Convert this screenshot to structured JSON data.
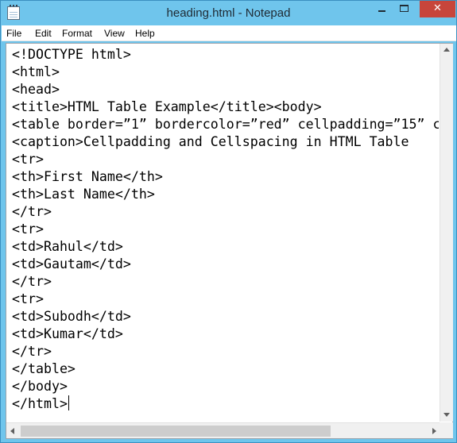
{
  "window": {
    "title": "heading.html - Notepad",
    "close_glyph": "✕",
    "app_icon": "notepad-icon"
  },
  "menu": [
    "File",
    "Edit",
    "Format",
    "View",
    "Help"
  ],
  "editor": {
    "lines": [
      "<!DOCTYPE html>",
      "<html>",
      "<head>",
      "<title>HTML Table Example</title><body>",
      "<table border=”1” bordercolor=”red” cellpadding=”15” c",
      "<caption>Cellpadding and Cellspacing in HTML Table",
      "<tr>",
      "<th>First Name</th>",
      "<th>Last Name</th>",
      "</tr>",
      "<tr>",
      "<td>Rahul</td>",
      "<td>Gautam</td>",
      "</tr>",
      "<tr>",
      "<td>Subodh</td>",
      "<td>Kumar</td>",
      "</tr>",
      "</table>",
      "</body>",
      "</html>"
    ]
  },
  "colors": {
    "titlebar": "#6fc5ec",
    "close_button": "#c7453b"
  }
}
